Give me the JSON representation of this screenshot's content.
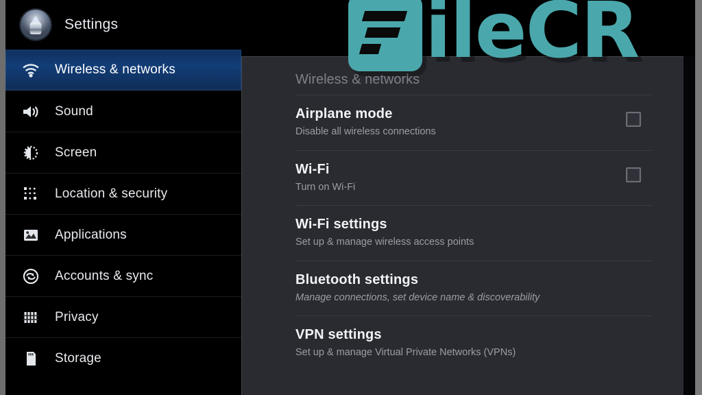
{
  "app": {
    "title": "Settings",
    "icon": "settings-badge-icon"
  },
  "colors": {
    "selected_nav_bg": "#123d77",
    "panel_bg": "#2a2b31",
    "sidebar_bg": "#000000",
    "watermark_teal": "#4aa8ac",
    "title_text": "#e9ecf1",
    "subtitle_text": "#9b9da5"
  },
  "sidebar": {
    "items": [
      {
        "label": "Wireless & networks",
        "icon": "wifi-icon",
        "selected": true
      },
      {
        "label": "Sound",
        "icon": "speaker-icon",
        "selected": false
      },
      {
        "label": "Screen",
        "icon": "brightness-icon",
        "selected": false
      },
      {
        "label": "Location & security",
        "icon": "location-grid-icon",
        "selected": false
      },
      {
        "label": "Applications",
        "icon": "applications-icon",
        "selected": false
      },
      {
        "label": "Accounts & sync",
        "icon": "sync-icon",
        "selected": false
      },
      {
        "label": "Privacy",
        "icon": "privacy-icon",
        "selected": false
      },
      {
        "label": "Storage",
        "icon": "storage-card-icon",
        "selected": false
      }
    ]
  },
  "panel": {
    "header": "Wireless & networks",
    "rows": [
      {
        "title": "Airplane mode",
        "subtitle": "Disable all wireless connections",
        "has_checkbox": true,
        "checked": false,
        "italic": false
      },
      {
        "title": "Wi-Fi",
        "subtitle": "Turn on Wi-Fi",
        "has_checkbox": true,
        "checked": false,
        "italic": false
      },
      {
        "title": "Wi-Fi settings",
        "subtitle": "Set up & manage wireless access points",
        "has_checkbox": false,
        "checked": false,
        "italic": false
      },
      {
        "title": "Bluetooth settings",
        "subtitle": "Manage connections, set device name & discoverability",
        "has_checkbox": false,
        "checked": false,
        "italic": true
      },
      {
        "title": "VPN settings",
        "subtitle": "Set up & manage Virtual Private Networks (VPNs)",
        "has_checkbox": false,
        "checked": false,
        "italic": false
      }
    ]
  },
  "watermark": {
    "mark_icon": "filecr-f-mark-icon",
    "text": "ileCR"
  }
}
